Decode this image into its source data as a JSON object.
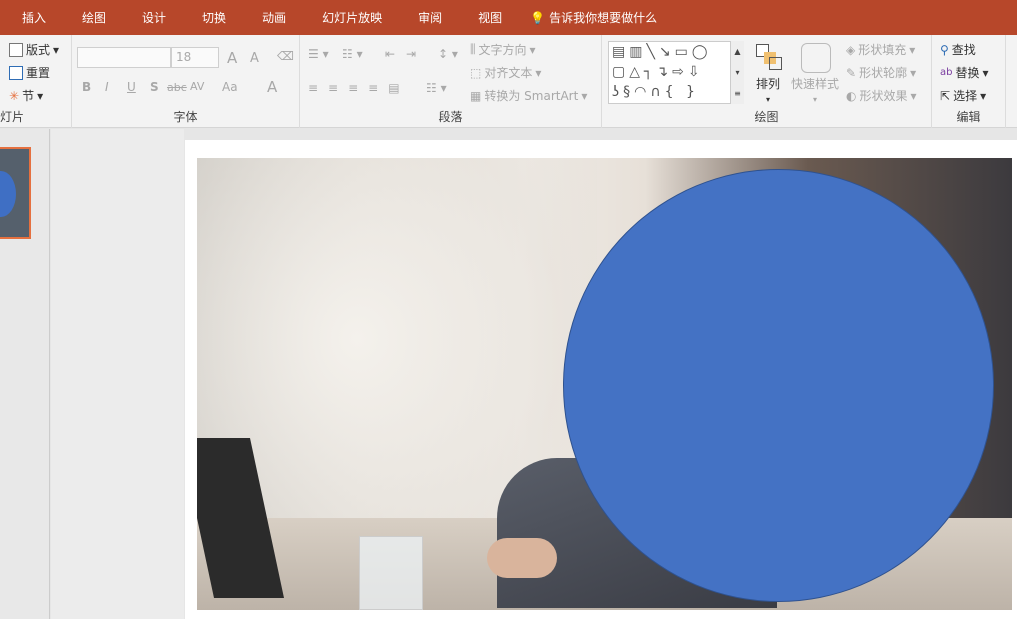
{
  "tabs": [
    "插入",
    "绘图",
    "设计",
    "切换",
    "动画",
    "幻灯片放映",
    "审阅",
    "视图"
  ],
  "tell_me": "告诉我你想要做什么",
  "slides_group": {
    "layout": "版式",
    "reset": "重置",
    "section": "节",
    "label": "幻灯片"
  },
  "font_group": {
    "font_name": "",
    "font_size": "18",
    "label": "字体",
    "bold": "B",
    "italic": "I",
    "underline": "U",
    "shadow": "S",
    "strike": "abc",
    "spacing": "AV",
    "case": "Aa",
    "color": "A",
    "grow": "A",
    "shrink": "A"
  },
  "paragraph_group": {
    "text_direction": "文字方向",
    "align_text": "对齐文本",
    "smartart": "转换为 SmartArt",
    "label": "段落"
  },
  "drawing_group": {
    "arrange": "排列",
    "quick_styles": "快速样式",
    "shape_fill": "形状填充",
    "shape_outline": "形状轮廓",
    "shape_effects": "形状效果",
    "label": "绘图"
  },
  "editing_group": {
    "find": "查找",
    "replace": "替换",
    "select": "选择",
    "label": "编辑"
  },
  "colors": {
    "accent": "#b7472a",
    "shape": "#4472c4",
    "selected_thumb": "#e5703f"
  }
}
